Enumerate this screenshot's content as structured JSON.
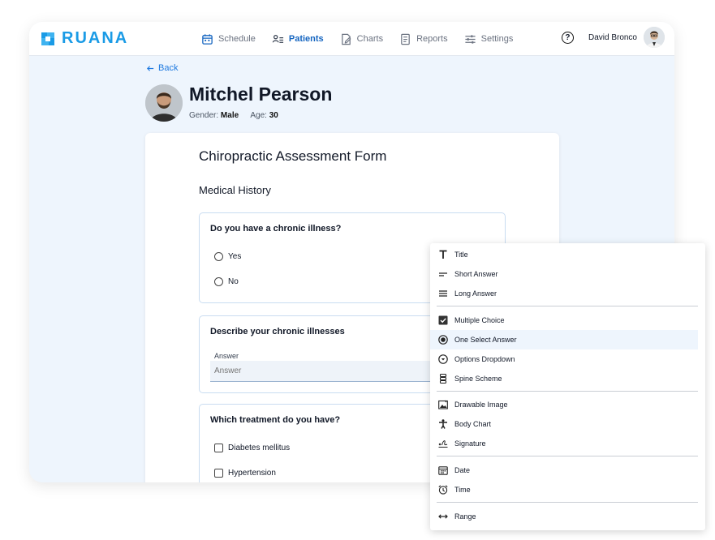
{
  "app": {
    "brand": "RUANA",
    "brand_color": "#1a9be6"
  },
  "nav": [
    {
      "label": "Schedule",
      "icon": "calendar-icon"
    },
    {
      "label": "Patients",
      "icon": "patients-list-icon",
      "active": true
    },
    {
      "label": "Charts",
      "icon": "chart-edit-icon"
    },
    {
      "label": "Reports",
      "icon": "report-icon"
    },
    {
      "label": "Settings",
      "icon": "sliders-icon"
    }
  ],
  "user": {
    "help": "?",
    "name": "David Bronco"
  },
  "back_label": "Back",
  "patient": {
    "name": "Mitchel Pearson",
    "gender_label": "Gender:",
    "gender": "Male",
    "age_label": "Age:",
    "age": "30"
  },
  "form": {
    "title": "Chiropractic Assessment Form",
    "section": "Medical History",
    "questions": [
      {
        "title": "Do you have a chronic illness?",
        "options": [
          "Yes",
          "No"
        ]
      },
      {
        "title": "Describe your chronic illnesses",
        "answer_label": "Answer",
        "placeholder": "Answer"
      },
      {
        "title": "Which treatment do you have?",
        "options": [
          "Diabetes mellitus",
          "Hypertension"
        ]
      }
    ]
  },
  "menu": {
    "items": [
      {
        "label": "Title",
        "icon": "title-text-icon"
      },
      {
        "label": "Short Answer",
        "icon": "short-answer-icon"
      },
      {
        "label": "Long Answer",
        "icon": "long-answer-icon"
      },
      {
        "label": "Multiple Choice",
        "icon": "checkbox-checked-icon"
      },
      {
        "label": "One Select Answer",
        "icon": "radio-selected-icon",
        "highlighted": true
      },
      {
        "label": "Options Dropdown",
        "icon": "dropdown-circle-icon"
      },
      {
        "label": "Spine Scheme",
        "icon": "spine-icon"
      },
      {
        "label": "Drawable Image",
        "icon": "image-icon"
      },
      {
        "label": "Body Chart",
        "icon": "body-icon"
      },
      {
        "label": "Signature",
        "icon": "signature-icon"
      },
      {
        "label": "Date",
        "icon": "calendar-icon"
      },
      {
        "label": "Time",
        "icon": "alarm-clock-icon"
      },
      {
        "label": "Range",
        "icon": "range-arrows-icon"
      }
    ]
  }
}
